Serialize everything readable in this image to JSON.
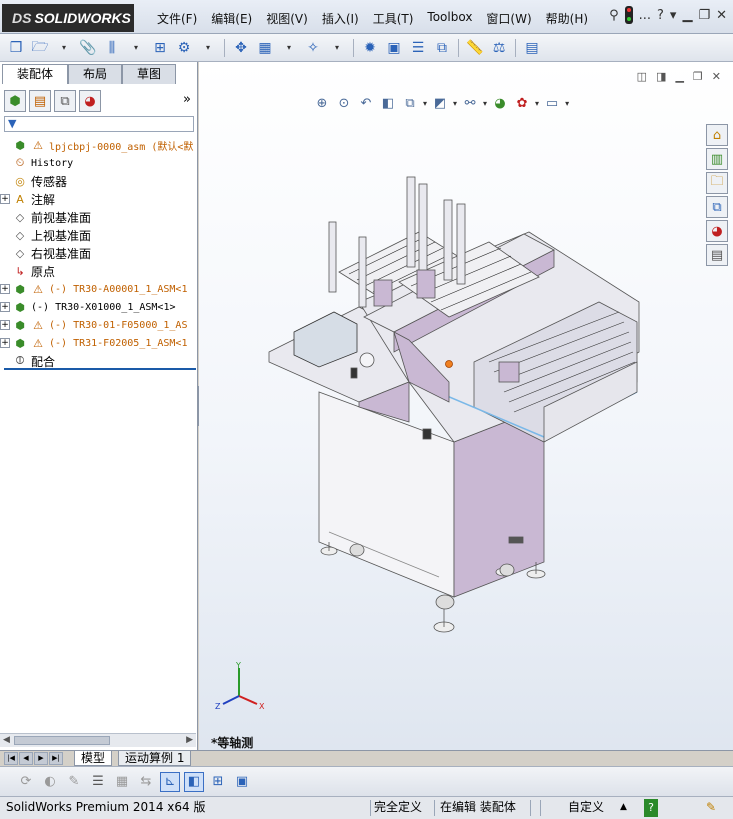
{
  "app": {
    "logo_prefix": "DS",
    "logo_text": "SOLIDWORKS"
  },
  "menu": {
    "items": [
      "文件(F)",
      "编辑(E)",
      "视图(V)",
      "插入(I)",
      "工具(T)",
      "Toolbox",
      "窗口(W)",
      "帮助(H)"
    ],
    "help_icon": "?",
    "right_dots": "..."
  },
  "left_panel": {
    "tabs": [
      "装配体",
      "布局",
      "草图"
    ],
    "more": "»",
    "tree": [
      {
        "label": "lpjcbpj-0000_asm  (默认<默",
        "icon": "assembly-icon",
        "warning": true,
        "expandable": false,
        "mono": true,
        "color": "#c06000"
      },
      {
        "label": "History",
        "icon": "history-icon",
        "expandable": false,
        "mono": true
      },
      {
        "label": "传感器",
        "icon": "sensor-icon",
        "expandable": false
      },
      {
        "label": "注解",
        "icon": "annotation-icon",
        "expandable": true
      },
      {
        "label": "前视基准面",
        "icon": "plane-icon",
        "expandable": false
      },
      {
        "label": "上视基准面",
        "icon": "plane-icon",
        "expandable": false
      },
      {
        "label": "右视基准面",
        "icon": "plane-icon",
        "expandable": false
      },
      {
        "label": "原点",
        "icon": "origin-icon",
        "expandable": false
      },
      {
        "label": "(-) TR30-A00001_1_ASM<1",
        "icon": "subassembly-icon",
        "warning": true,
        "expandable": true,
        "mono": true,
        "color": "#c06000"
      },
      {
        "label": "(-) TR30-X01000_1_ASM<1>",
        "icon": "subassembly-icon",
        "warning": false,
        "expandable": true,
        "mono": true
      },
      {
        "label": "(-) TR30-01-F05000_1_AS",
        "icon": "subassembly-icon",
        "warning": true,
        "expandable": true,
        "mono": true,
        "color": "#c06000"
      },
      {
        "label": "(-) TR31-F02005_1_ASM<1",
        "icon": "subassembly-icon",
        "warning": true,
        "expandable": true,
        "mono": true,
        "color": "#c06000"
      },
      {
        "label": "配合",
        "icon": "mates-icon",
        "expandable": false
      }
    ]
  },
  "viewport": {
    "view_label": "*等轴测",
    "triad": {
      "x": "X",
      "y": "Y",
      "z": "Z"
    }
  },
  "bottom_tabs": [
    "模型",
    "运动算例 1"
  ],
  "status_bar": {
    "product": "SolidWorks Premium 2014 x64 版",
    "definition": "完全定义",
    "editing": "在编辑 装配体",
    "units": "自定义",
    "units_arrow": "▲",
    "help": "?"
  },
  "colors": {
    "machine_body": "#c9b8d3",
    "machine_frame": "#e9e9ef",
    "highlight": "#1a5aa8",
    "warning": "#c06000"
  }
}
